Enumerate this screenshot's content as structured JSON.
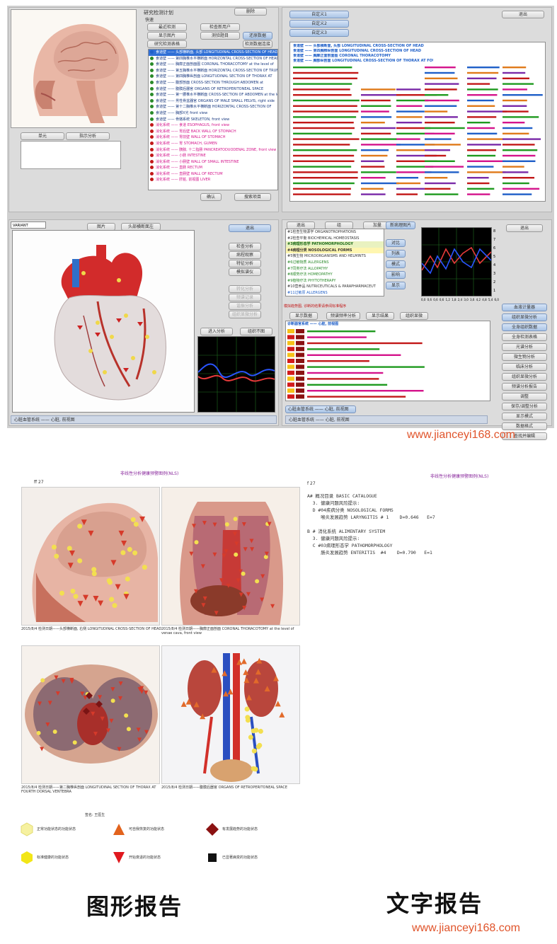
{
  "top_left_window": {
    "title": "研究检测计划",
    "subtitle": "快速",
    "buttons": [
      "最近检测",
      "检查新用户",
      "显示图片",
      "测验题目",
      "研究检测表格",
      "删除",
      "还原数据",
      "检测数据连接"
    ],
    "tabs": [
      "单元",
      "指示分析"
    ],
    "list_rows": [
      {
        "color": "#1f5fc8",
        "text": "食道壁 —— 头部横断面, 头部 LONGITUDINAL CROSS-SECTION OF HEAD",
        "highlight": true
      },
      {
        "color": "#2a8a2a",
        "text": "食道壁 —— 第四胸椎水平横断面 HORIZONTAL CROSS-SECTION OF HEAD"
      },
      {
        "color": "#2a8a2a",
        "text": "食道壁 —— 胸廓正面剖面图 CORONAL THORACOTOMY at the level of"
      },
      {
        "color": "#2a8a2a",
        "text": "食道壁 —— 第五胸椎水平横断面 HORIZONTAL CROSS-SECTION OF TRUN"
      },
      {
        "color": "#2a8a2a",
        "text": "食道壁 —— 第四胸椎纵剖面 LONGITUDINAL SECTION OF THORAX AT"
      },
      {
        "color": "#2a8a2a",
        "text": "食道壁 —— 腹部剖面 CROSS-SECTION THROUGH ABDOMEN at"
      },
      {
        "color": "#2a8a2a",
        "text": "食道壁 —— 腹膜后器官 ORGANS OF RETROPERITONEAL SPACE"
      },
      {
        "color": "#2a8a2a",
        "text": "食道壁 —— 第一腰椎水平横断面 CROSS-SECTION OF ABDOMEN at the level"
      },
      {
        "color": "#2a8a2a",
        "text": "食道壁 —— 男性骨盆器官 ORGANS OF MALE SMALL PELVIS, right side"
      },
      {
        "color": "#2a8a2a",
        "text": "食道壁 —— 第十二胸椎水平横断面 HORIZONTAL CROSS-SECTION OF"
      },
      {
        "color": "#2a8a2a",
        "text": "食道壁 —— 胸部X光 front view"
      },
      {
        "color": "#2a8a2a",
        "text": "食道壁 —— 骨骼系统 SKELETON, front view"
      },
      {
        "color": "#c21818",
        "text": "消化系统 —— 食道 ESOPHAGUS, front view",
        "pink": true
      },
      {
        "color": "#c21818",
        "text": "消化系统 —— 胃后壁 BACK WALL OF STOMACH",
        "pink": true
      },
      {
        "color": "#c21818",
        "text": "消化系统 —— 胃前壁 WALL OF STOMACH",
        "pink": true
      },
      {
        "color": "#c21818",
        "text": "消化系统 —— 胃 STOMACH, GUMEN",
        "pink": true
      },
      {
        "color": "#c21818",
        "text": "消化系统 —— 胰腺, 十二指肠 PANCREATODUODENAL ZONE, front view",
        "pink": true
      },
      {
        "color": "#c21818",
        "text": "消化系统 —— 小肠 INTESTINE",
        "pink": true
      },
      {
        "color": "#c21818",
        "text": "消化系统 —— 小肠壁 WALL OF SMALL INTESTINE",
        "pink": true
      },
      {
        "color": "#c21818",
        "text": "消化系统 —— 直肠 RECTUM",
        "pink": true
      },
      {
        "color": "#c21818",
        "text": "消化系统 —— 直肠壁 WALL OF RECTUM",
        "pink": true
      },
      {
        "color": "#c21818",
        "text": "消化系统 —— 肝脏, 前视图 LIVER",
        "pink": true
      }
    ],
    "footer_buttons": [
      "确认",
      "搜索项目"
    ]
  },
  "top_right_window": {
    "buttons": [
      "自定义1",
      "自定义2",
      "自定义3",
      "退出"
    ],
    "rows": [
      "食道壁 —— 头部横断面, 头部 LONGITUDINAL CROSS-SECTION OF HEAD",
      "食道壁 —— 第四胸椎纵剖面 LONGITUDINAL CROSS-SECTION OF HEAD",
      "食道壁 —— 胸廓正面剖面图 CORONAL THORACOTOMY",
      "食道壁 —— 胸部纵剖面 LONGITUDINAL CROSS-SECTION OF THORAX AT FOURTH DORSAL VERTEBRA"
    ]
  },
  "heart_window": {
    "combo": "VARIANT",
    "buttons_top": [
      "图片",
      "头部横断面左"
    ],
    "side_buttons": [
      "退出",
      "检查分析",
      "病程观察",
      "特征分析",
      "模拟谱仪"
    ],
    "disabled_buttons": [
      "转化分析",
      "频谱记录",
      "谐振分析",
      "组织显微分析"
    ],
    "bottom_buttons": [
      "进入分析",
      "组织不图"
    ],
    "status": "心脏血管系统 —— 心脏, 前视图"
  },
  "analysis_window": {
    "top_buttons": [
      "退出",
      "组",
      "加量"
    ],
    "list": [
      {
        "text": "#1检查生物源学 ORGANOTROPHATIONS",
        "color": "#333"
      },
      {
        "text": "#2检查平衡 BIOCHEMICAL HOMEOSTASIS",
        "color": "#333"
      },
      {
        "text": "#3病理形态学 PATHOMORPHOLOGY",
        "color": "#333",
        "hl": true
      },
      {
        "text": "#4病理分类 NOSOLOGICAL FORMS",
        "color": "#333",
        "hl2": true
      },
      {
        "text": "#5微生物 MICROORGANISMS AND HELMINTS",
        "color": "#333"
      },
      {
        "text": "#6过敏物质 ALLERGENS",
        "color": "#2a8a2a"
      },
      {
        "text": "#7同类疗法 ALLOPATHY",
        "color": "#2a8a2a"
      },
      {
        "text": "#8顺势疗法 HOMEOPATHY",
        "color": "#2a8a2a"
      },
      {
        "text": "#9植物疗法 PHYTOTHERAPY",
        "color": "#2a8a2a"
      },
      {
        "text": "#10营养品 NUTRICEUTICALS & PARAPHARMACEUT",
        "color": "#333"
      },
      {
        "text": "#11过敏原 ALLERGENS",
        "color": "#1f5fc8"
      }
    ],
    "right_buttons": [
      "新病理图片",
      "对比",
      "列表",
      "模式",
      "影响",
      "显示"
    ],
    "red_note": "模拟趋势图, 诊断的结果请参阅标准程序",
    "table_tabs": [
      "显示数据",
      "频谱频率分析",
      "显示结果",
      "组织显微"
    ],
    "table_header": "诊断器官系统 —— 心脏, 前视图",
    "right_column": [
      "血液计量器",
      "组织显微分析",
      "全身组织数据",
      "全身检测表格",
      "光谱分析",
      "微生物分析",
      "临床分析",
      "组织显微分析",
      "频谱分析报告",
      "调整",
      "保存/调整分析",
      "显示模式",
      "数据格式",
      "查找并编辑"
    ],
    "bottom_left": "心脏血管系统 —— 心脏, 前视图",
    "axis_labels": [
      "0,0",
      "0,6",
      "0,6",
      "0,6",
      "1,2",
      "1,8",
      "2,4",
      "3,0",
      "3,6",
      "4,2",
      "4,8",
      "5,4",
      "6,0"
    ],
    "y_labels": [
      "1",
      "2",
      "3",
      "4",
      "5",
      "6",
      "7",
      "8"
    ]
  },
  "watermark_top": "www.jianceyi168.com",
  "graphic_report": {
    "title": "非线性分析健康预警图例(NLS)",
    "code": "ff  27",
    "captions": [
      "2015/8/4 检测日期——头部横断面, 右侧 LONGITUDINAL CROSS-SECTION OF HEAD",
      "2015/8/4 检测日期——胸廓正面剖面 CORONAL THORACOTOMY at the level of venae cava, front view",
      "2015/8/4 检测日期——第二胸椎纵剖面 LONGITUDINAL SECTION OF THORAX AT FOURTH DORSAL VENTEBRA",
      "2015/8/4 检测日期——腹膜后器官 ORGANS OF RETROPERITONEAL SPACE"
    ],
    "signature": "签名: 王医生",
    "legend": [
      "正常功能状态的功能状态",
      "可自我恢复的功能状态",
      "有发展趋势的功能状态",
      "标准健康的功能状态",
      "开始衰退的功能状态",
      "已显著病变的功能状态"
    ]
  },
  "text_report": {
    "title": "非线性分析健康预警图例(NLS)",
    "code": "f  27",
    "lines": [
      "A# 概况目录 BASIC CATALOGUE",
      "  3. 健康问题风险提示:",
      "  D #04疾病分类 NOSOLOGICAL FORMS",
      "     喉炎发展趋势 LARYNGITIS # 1    D=0.646   E=7",
      "",
      "B # 消化系统 ALIMENTARY SYSTEM",
      "  3. 健康问题风险提示:",
      "  C #03病理形态学 PATHOMORPHOLOGY",
      "     肠炎发展趋势 ENTERITIS  #4    D=0.790   E=1"
    ]
  },
  "footer": {
    "left_label": "图形报告",
    "right_label": "文字报告",
    "url": "www.jianceyi168.com"
  },
  "colors": {
    "accent_blue": "#1f5fc8",
    "pink": "#d4148b",
    "url_orange": "#e0542b"
  }
}
